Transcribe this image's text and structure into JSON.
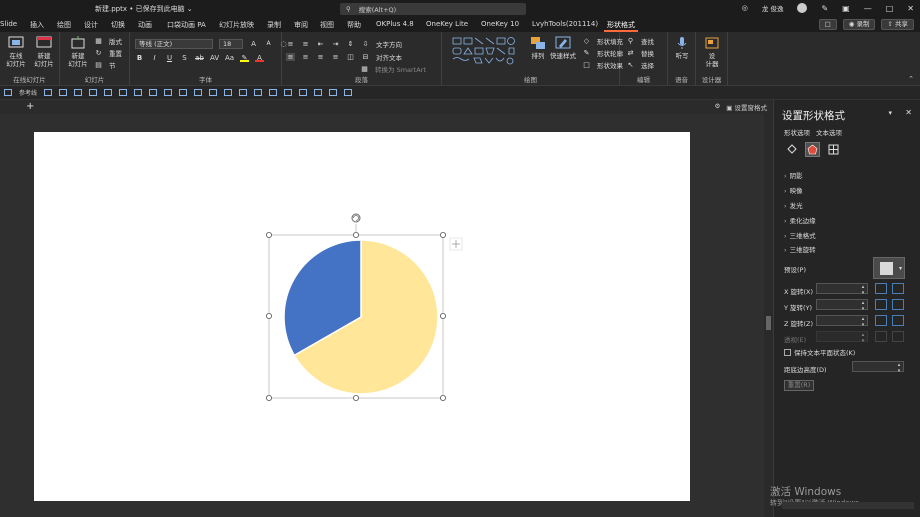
{
  "window": {
    "title": "新建.pptx • 已保存到此电脑 ⌄",
    "search_placeholder": "搜索(Alt+Q)",
    "user": "龙 俊逸"
  },
  "menu": {
    "tabs": [
      "Slide",
      "插入",
      "绘图",
      "设计",
      "切换",
      "动画",
      "口袋动画 PA",
      "幻灯片放映",
      "录制",
      "审阅",
      "视图",
      "帮助",
      "OKPlus 4.8",
      "OneKey Lite",
      "OneKey 10",
      "LvyhTools(201114)",
      "形状格式"
    ],
    "active": "形状格式",
    "record_label": "录制",
    "share_label": "共享"
  },
  "ribbon": {
    "groups": {
      "pro": "在线幻灯片",
      "slides": "幻灯片",
      "font": "字体",
      "paragraph": "段落",
      "drawing": "绘图",
      "editing": "编辑",
      "voice": "语音",
      "designer": "设计器"
    },
    "buttons": {
      "online_slides": "在线\n幻灯片",
      "new_slide_beta": "新建\n幻灯片",
      "new_slide": "新建\n幻灯片",
      "layout": "版式",
      "reset": "重置",
      "section": "节",
      "text_direction": "文字方向",
      "align_text": "对齐文本",
      "smartart": "转换为 SmartArt",
      "arrange": "排列",
      "quick_styles": "快速样式",
      "shape_fill": "形状填充",
      "shape_outline": "形状轮廓",
      "shape_effects": "形状效果",
      "find": "查找",
      "replace": "替换",
      "select": "选择",
      "dictate": "听写",
      "designer": "设\n计器"
    },
    "font_name": "等线 (正文)",
    "font_size": "18"
  },
  "qat": {
    "ref_line": "参考线"
  },
  "docbar": {
    "restore_label": "设置窗格式"
  },
  "pane": {
    "title": "设置形状格式",
    "tabs": [
      "形状选项",
      "文本选项"
    ],
    "sections": [
      "阴影",
      "映像",
      "发光",
      "柔化边缘",
      "三维格式",
      "三维旋转"
    ],
    "preset_label": "预设(P)",
    "x_rotation": "X 旋转(X)",
    "y_rotation": "Y 旋转(Y)",
    "z_rotation": "Z 旋转(Z)",
    "perspective": "透视(E)",
    "keep_text_flat": "保持文本平面状态(K)",
    "distance_from_ground": "距底边高度(D)",
    "reset": "重置(R)"
  },
  "watermark": {
    "line1": "激活 Windows",
    "line2": "转到\"设置\"以激活 Windows。"
  },
  "chart_data": {
    "type": "pie",
    "values": [
      66.7,
      33.3
    ],
    "colors": [
      "#FFE699",
      "#4472C4"
    ]
  }
}
